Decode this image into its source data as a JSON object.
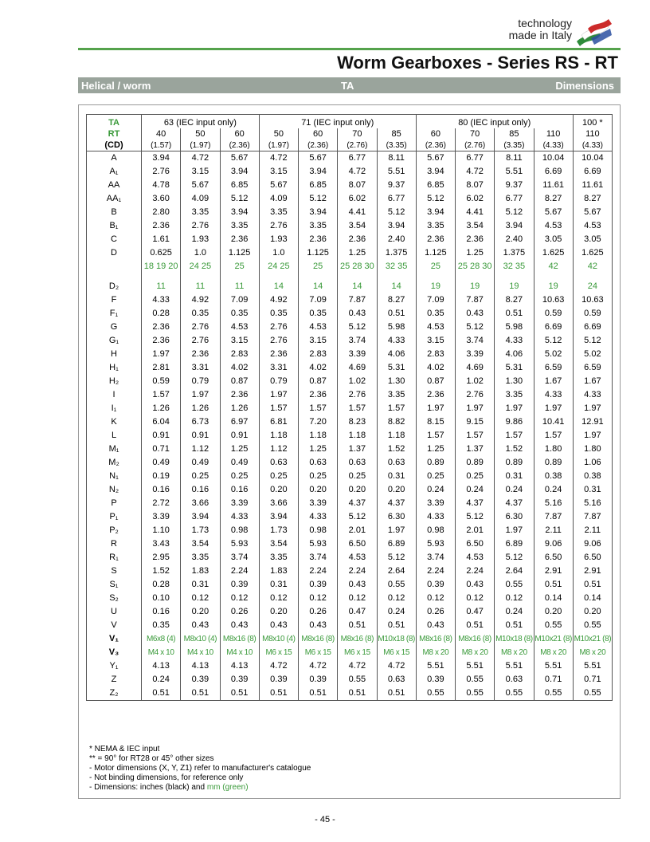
{
  "header": {
    "brand_line1": "technology",
    "brand_line2": "made in Italy",
    "title": "Worm Gearboxes - Series RS - RT",
    "band_left": "Helical / worm",
    "band_center": "TA",
    "band_right": "Dimensions"
  },
  "table": {
    "ta_label": "TA",
    "rt_label": "RT",
    "cd_label": "(CD)",
    "groups": [
      "63 (IEC input only)",
      "71 (IEC input only)",
      "80 (IEC input only)",
      "100 *"
    ],
    "sizes": [
      "40",
      "50",
      "60",
      "50",
      "60",
      "70",
      "85",
      "60",
      "70",
      "85",
      "110",
      "110"
    ],
    "sizes_in": [
      "(1.57)",
      "(1.97)",
      "(2.36)",
      "(1.97)",
      "(2.36)",
      "(2.76)",
      "(3.35)",
      "(2.36)",
      "(2.76)",
      "(3.35)",
      "(4.33)",
      "(4.33)"
    ],
    "rows": [
      {
        "label": "A",
        "values": [
          "3.94",
          "4.72",
          "5.67",
          "4.72",
          "5.67",
          "6.77",
          "8.11",
          "5.67",
          "6.77",
          "8.11",
          "10.04",
          "10.04"
        ]
      },
      {
        "label": "A₁",
        "values": [
          "2.76",
          "3.15",
          "3.94",
          "3.15",
          "3.94",
          "4.72",
          "5.51",
          "3.94",
          "4.72",
          "5.51",
          "6.69",
          "6.69"
        ]
      },
      {
        "label": "AA",
        "values": [
          "4.78",
          "5.67",
          "6.85",
          "5.67",
          "6.85",
          "8.07",
          "9.37",
          "6.85",
          "8.07",
          "9.37",
          "11.61",
          "11.61"
        ]
      },
      {
        "label": "AA₁",
        "values": [
          "3.60",
          "4.09",
          "5.12",
          "4.09",
          "5.12",
          "6.02",
          "6.77",
          "5.12",
          "6.02",
          "6.77",
          "8.27",
          "8.27"
        ]
      },
      {
        "label": "B",
        "values": [
          "2.80",
          "3.35",
          "3.94",
          "3.35",
          "3.94",
          "4.41",
          "5.12",
          "3.94",
          "4.41",
          "5.12",
          "5.67",
          "5.67"
        ]
      },
      {
        "label": "B₁",
        "values": [
          "2.36",
          "2.76",
          "3.35",
          "2.76",
          "3.35",
          "3.54",
          "3.94",
          "3.35",
          "3.54",
          "3.94",
          "4.53",
          "4.53"
        ]
      },
      {
        "label": "C",
        "values": [
          "1.61",
          "1.93",
          "2.36",
          "1.93",
          "2.36",
          "2.36",
          "2.40",
          "2.36",
          "2.36",
          "2.40",
          "3.05",
          "3.05"
        ]
      },
      {
        "label": "D",
        "values": [
          "0.625",
          "1.0",
          "1.125",
          "1.0",
          "1.125",
          "1.25",
          "1.375",
          "1.125",
          "1.25",
          "1.375",
          "1.625",
          "1.625"
        ]
      },
      {
        "label": "",
        "green": true,
        "values": [
          "18 19 20",
          "24 25",
          "25",
          "24 25",
          "25",
          "25 28 30",
          "32 35",
          "25",
          "25 28 30",
          "32 35",
          "42",
          "42"
        ]
      },
      {
        "gap": true
      },
      {
        "label": "D₂",
        "green": true,
        "values": [
          "11",
          "11",
          "11",
          "14",
          "14",
          "14",
          "14",
          "19",
          "19",
          "19",
          "19",
          "24"
        ]
      },
      {
        "label": "F",
        "values": [
          "4.33",
          "4.92",
          "7.09",
          "4.92",
          "7.09",
          "7.87",
          "8.27",
          "7.09",
          "7.87",
          "8.27",
          "10.63",
          "10.63"
        ]
      },
      {
        "label": "F₁",
        "values": [
          "0.28",
          "0.35",
          "0.35",
          "0.35",
          "0.35",
          "0.43",
          "0.51",
          "0.35",
          "0.43",
          "0.51",
          "0.59",
          "0.59"
        ]
      },
      {
        "label": "G",
        "values": [
          "2.36",
          "2.76",
          "4.53",
          "2.76",
          "4.53",
          "5.12",
          "5.98",
          "4.53",
          "5.12",
          "5.98",
          "6.69",
          "6.69"
        ]
      },
      {
        "label": "G₁",
        "values": [
          "2.36",
          "2.76",
          "3.15",
          "2.76",
          "3.15",
          "3.74",
          "4.33",
          "3.15",
          "3.74",
          "4.33",
          "5.12",
          "5.12"
        ]
      },
      {
        "label": "H",
        "values": [
          "1.97",
          "2.36",
          "2.83",
          "2.36",
          "2.83",
          "3.39",
          "4.06",
          "2.83",
          "3.39",
          "4.06",
          "5.02",
          "5.02"
        ]
      },
      {
        "label": "H₁",
        "values": [
          "2.81",
          "3.31",
          "4.02",
          "3.31",
          "4.02",
          "4.69",
          "5.31",
          "4.02",
          "4.69",
          "5.31",
          "6.59",
          "6.59"
        ]
      },
      {
        "label": "H₂",
        "values": [
          "0.59",
          "0.79",
          "0.87",
          "0.79",
          "0.87",
          "1.02",
          "1.30",
          "0.87",
          "1.02",
          "1.30",
          "1.67",
          "1.67"
        ]
      },
      {
        "label": "I",
        "values": [
          "1.57",
          "1.97",
          "2.36",
          "1.97",
          "2.36",
          "2.76",
          "3.35",
          "2.36",
          "2.76",
          "3.35",
          "4.33",
          "4.33"
        ]
      },
      {
        "label": "I₁",
        "values": [
          "1.26",
          "1.26",
          "1.26",
          "1.57",
          "1.57",
          "1.57",
          "1.57",
          "1.97",
          "1.97",
          "1.97",
          "1.97",
          "1.97"
        ]
      },
      {
        "label": "K",
        "values": [
          "6.04",
          "6.73",
          "6.97",
          "6.81",
          "7.20",
          "8.23",
          "8.82",
          "8.15",
          "9.15",
          "9.86",
          "10.41",
          "12.91"
        ]
      },
      {
        "label": "L",
        "values": [
          "0.91",
          "0.91",
          "0.91",
          "1.18",
          "1.18",
          "1.18",
          "1.18",
          "1.57",
          "1.57",
          "1.57",
          "1.57",
          "1.97"
        ]
      },
      {
        "label": "M₁",
        "values": [
          "0.71",
          "1.12",
          "1.25",
          "1.12",
          "1.25",
          "1.37",
          "1.52",
          "1.25",
          "1.37",
          "1.52",
          "1.80",
          "1.80"
        ]
      },
      {
        "label": "M₂",
        "values": [
          "0.49",
          "0.49",
          "0.49",
          "0.63",
          "0.63",
          "0.63",
          "0.63",
          "0.89",
          "0.89",
          "0.89",
          "0.89",
          "1.06"
        ]
      },
      {
        "label": "N₁",
        "values": [
          "0.19",
          "0.25",
          "0.25",
          "0.25",
          "0.25",
          "0.25",
          "0.31",
          "0.25",
          "0.25",
          "0.31",
          "0.38",
          "0.38"
        ]
      },
      {
        "label": "N₂",
        "values": [
          "0.16",
          "0.16",
          "0.16",
          "0.20",
          "0.20",
          "0.20",
          "0.20",
          "0.24",
          "0.24",
          "0.24",
          "0.24",
          "0.31"
        ]
      },
      {
        "label": "P",
        "values": [
          "2.72",
          "3.66",
          "3.39",
          "3.66",
          "3.39",
          "4.37",
          "4.37",
          "3.39",
          "4.37",
          "4.37",
          "5.16",
          "5.16"
        ]
      },
      {
        "label": "P₁",
        "values": [
          "3.39",
          "3.94",
          "4.33",
          "3.94",
          "4.33",
          "5.12",
          "6.30",
          "4.33",
          "5.12",
          "6.30",
          "7.87",
          "7.87"
        ]
      },
      {
        "label": "P₂",
        "values": [
          "1.10",
          "1.73",
          "0.98",
          "1.73",
          "0.98",
          "2.01",
          "1.97",
          "0.98",
          "2.01",
          "1.97",
          "2.11",
          "2.11"
        ]
      },
      {
        "label": "R",
        "values": [
          "3.43",
          "3.54",
          "5.93",
          "3.54",
          "5.93",
          "6.50",
          "6.89",
          "5.93",
          "6.50",
          "6.89",
          "9.06",
          "9.06"
        ]
      },
      {
        "label": "R₁",
        "values": [
          "2.95",
          "3.35",
          "3.74",
          "3.35",
          "3.74",
          "4.53",
          "5.12",
          "3.74",
          "4.53",
          "5.12",
          "6.50",
          "6.50"
        ]
      },
      {
        "label": "S",
        "values": [
          "1.52",
          "1.83",
          "2.24",
          "1.83",
          "2.24",
          "2.24",
          "2.64",
          "2.24",
          "2.24",
          "2.64",
          "2.91",
          "2.91"
        ]
      },
      {
        "label": "S₁",
        "values": [
          "0.28",
          "0.31",
          "0.39",
          "0.31",
          "0.39",
          "0.43",
          "0.55",
          "0.39",
          "0.43",
          "0.55",
          "0.51",
          "0.51"
        ]
      },
      {
        "label": "S₂",
        "values": [
          "0.10",
          "0.12",
          "0.12",
          "0.12",
          "0.12",
          "0.12",
          "0.12",
          "0.12",
          "0.12",
          "0.12",
          "0.14",
          "0.14"
        ]
      },
      {
        "label": "U",
        "values": [
          "0.16",
          "0.20",
          "0.26",
          "0.20",
          "0.26",
          "0.47",
          "0.24",
          "0.26",
          "0.47",
          "0.24",
          "0.20",
          "0.20"
        ]
      },
      {
        "label": "V",
        "values": [
          "0.35",
          "0.43",
          "0.43",
          "0.43",
          "0.43",
          "0.51",
          "0.51",
          "0.43",
          "0.51",
          "0.51",
          "0.55",
          "0.55"
        ]
      },
      {
        "label": "V₁",
        "green": true,
        "bold": true,
        "values": [
          "M6x8 (4)",
          "M8x10 (4)",
          "M8x16 (8)",
          "M8x10 (4)",
          "M8x16 (8)",
          "M8x16 (8)",
          "M10x18 (8)",
          "M8x16 (8)",
          "M8x16 (8)",
          "M10x18 (8)",
          "M10x21 (8)",
          "M10x21 (8)"
        ]
      },
      {
        "label": "V₃",
        "green": true,
        "bold": true,
        "values": [
          "M4 x 10",
          "M4 x 10",
          "M4 x 10",
          "M6 x 15",
          "M6 x 15",
          "M6 x 15",
          "M6 x 15",
          "M8 x 20",
          "M8 x 20",
          "M8 x 20",
          "M8 x 20",
          "M8 x 20"
        ]
      },
      {
        "label": "Y₁",
        "values": [
          "4.13",
          "4.13",
          "4.13",
          "4.72",
          "4.72",
          "4.72",
          "4.72",
          "5.51",
          "5.51",
          "5.51",
          "5.51",
          "5.51"
        ]
      },
      {
        "label": "Z",
        "values": [
          "0.24",
          "0.39",
          "0.39",
          "0.39",
          "0.39",
          "0.55",
          "0.63",
          "0.39",
          "0.55",
          "0.63",
          "0.71",
          "0.71"
        ]
      },
      {
        "label": "Z₂",
        "values": [
          "0.51",
          "0.51",
          "0.51",
          "0.51",
          "0.51",
          "0.51",
          "0.51",
          "0.55",
          "0.55",
          "0.55",
          "0.55",
          "0.55"
        ]
      }
    ]
  },
  "notes": [
    "* NEMA & IEC input",
    "** = 90° for RT28 or 45° other sizes",
    "- Motor dimensions (X, Y, Z1) refer to manufacturer's catalogue",
    "- Not binding dimensions, for reference only"
  ],
  "note_last": {
    "prefix": "- Dimensions: inches (black)  and ",
    "green": "mm (green)"
  },
  "page_number": "- 45 -",
  "colors": {
    "green": "#3a9a3a",
    "topline": "#55a24c",
    "band": "#9aa49c"
  }
}
